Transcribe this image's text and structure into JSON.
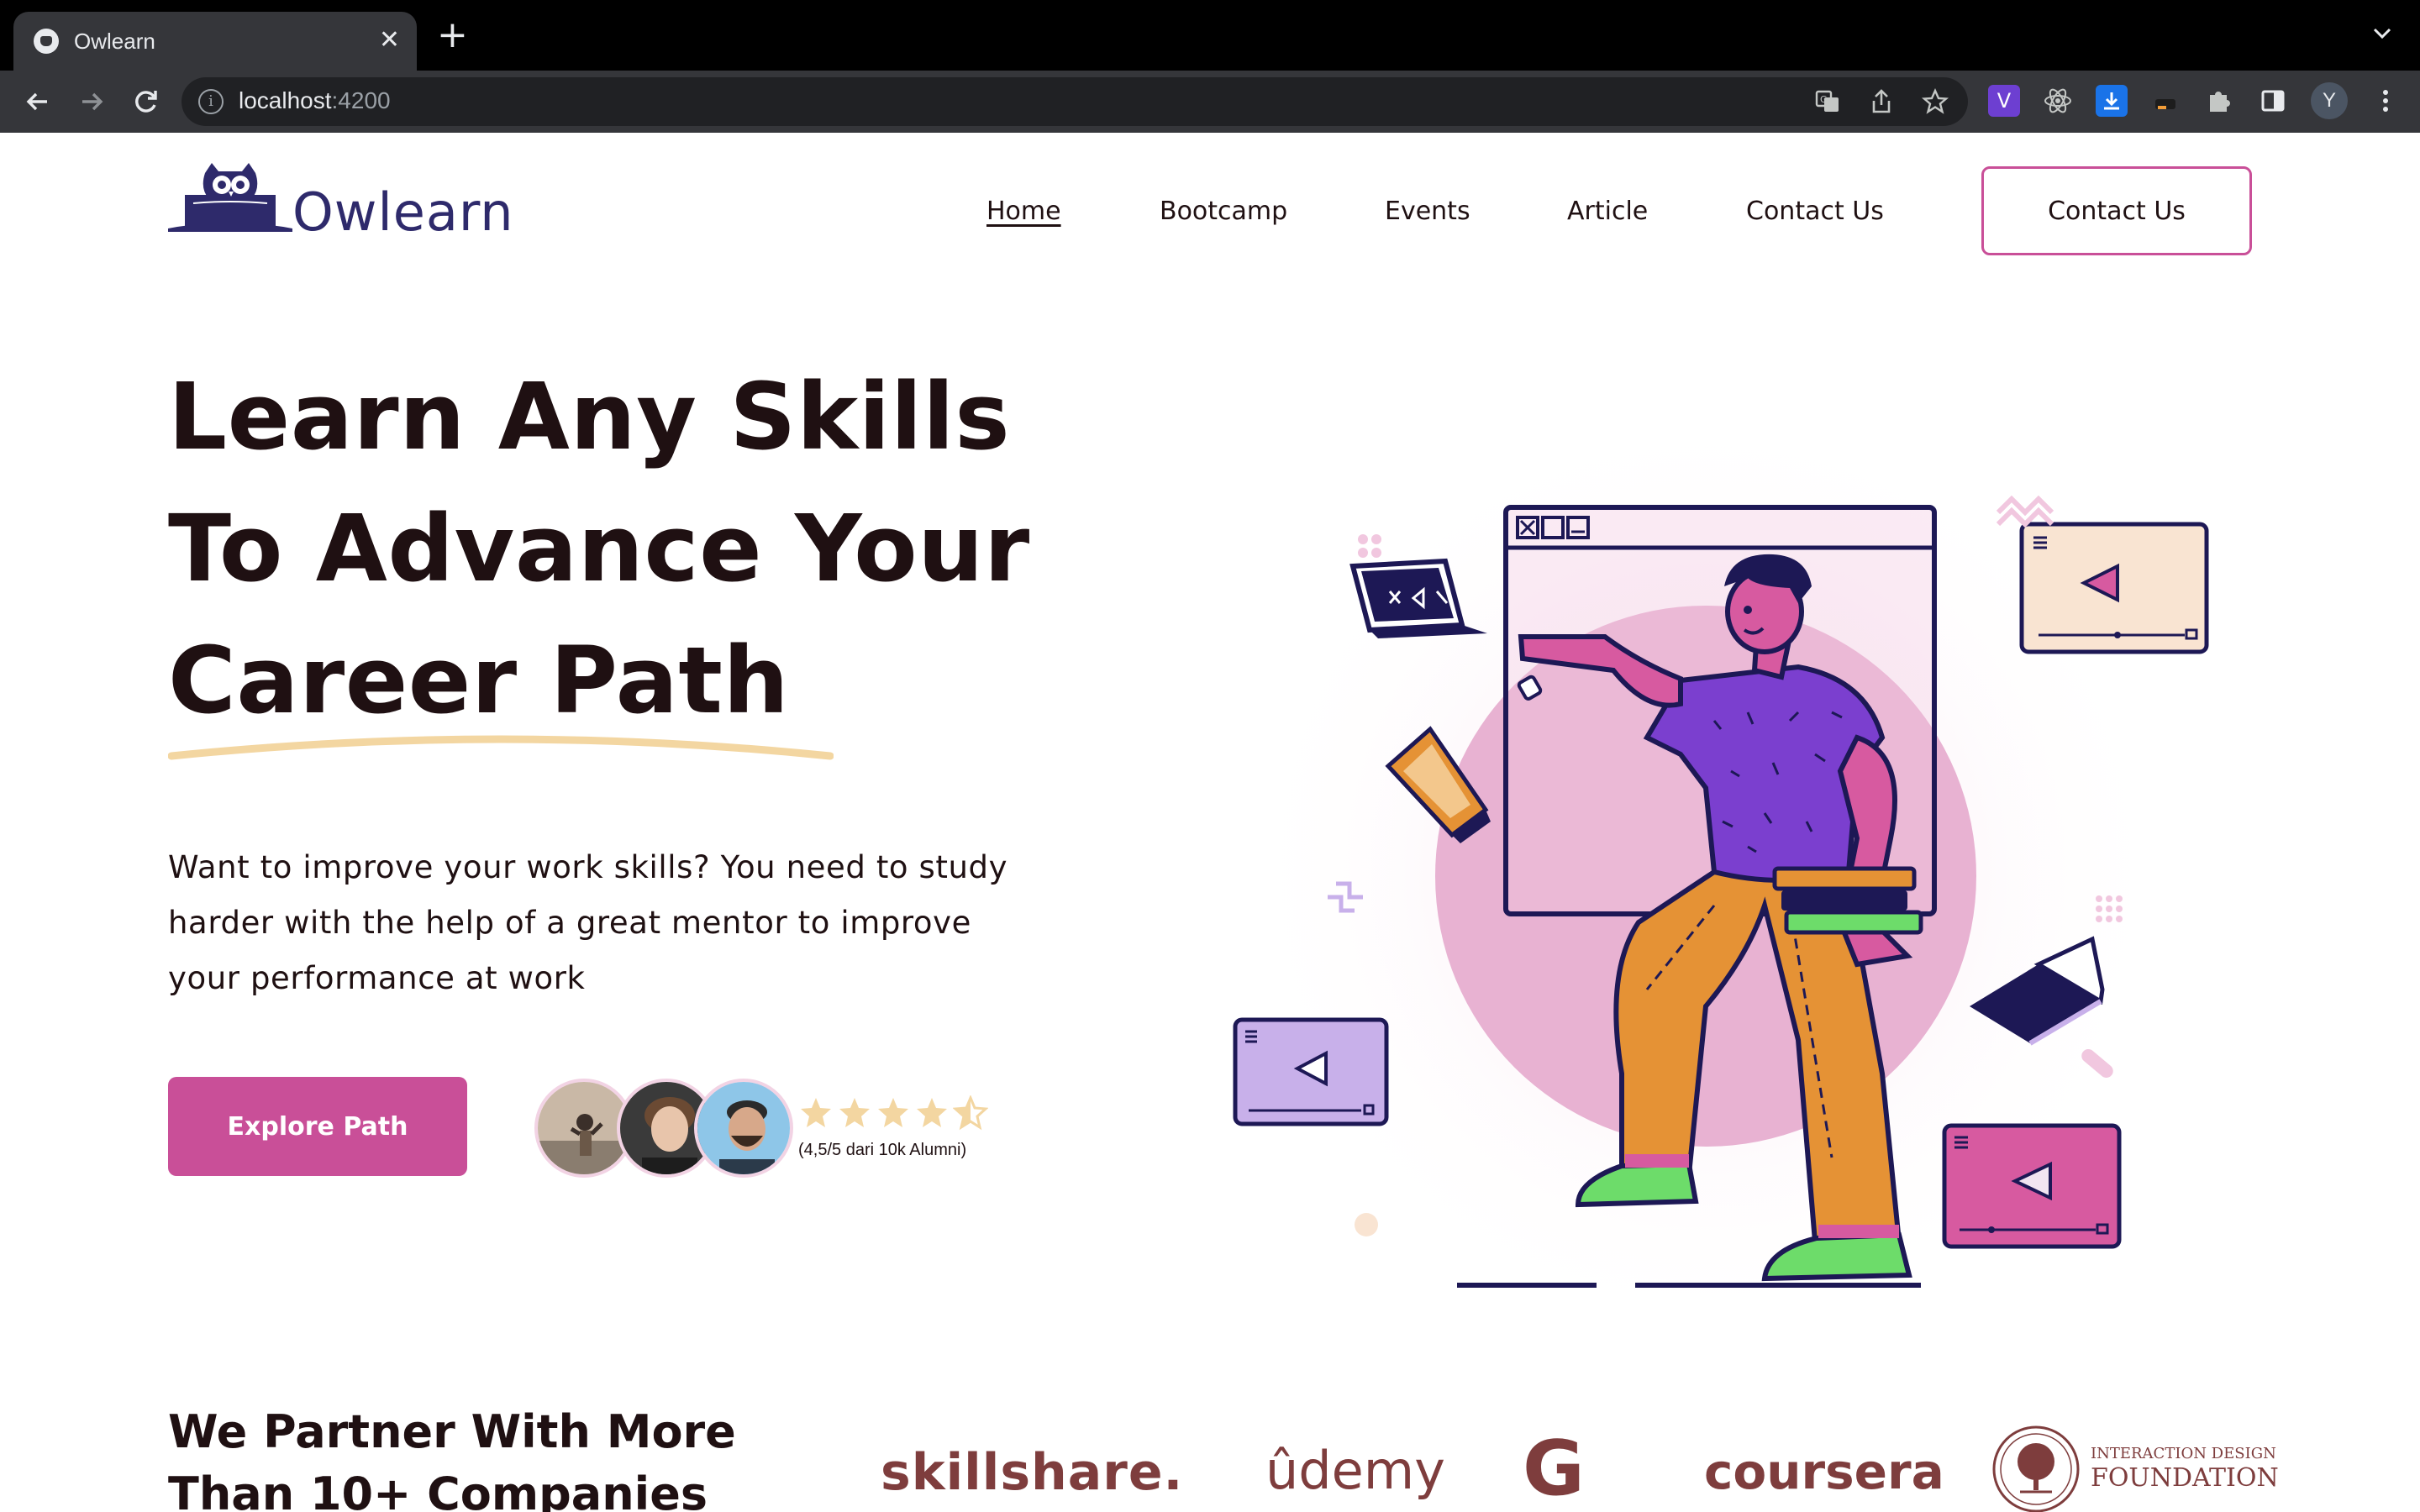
{
  "browser": {
    "tab_title": "Owlearn",
    "tab_close": "✕",
    "new_tab": "+",
    "url_host": "localhost",
    "url_port": ":4200",
    "profile_initial": "Y"
  },
  "header": {
    "logo_text": "Owlearn",
    "nav": [
      {
        "label": "Home",
        "active": true
      },
      {
        "label": "Bootcamp",
        "active": false
      },
      {
        "label": "Events",
        "active": false
      },
      {
        "label": "Article",
        "active": false
      },
      {
        "label": "Contact Us",
        "active": false
      }
    ],
    "cta_label": "Contact Us"
  },
  "hero": {
    "title_lines": [
      "Learn Any Skills",
      "To Advance Your",
      "Career Path"
    ],
    "description": "Want to improve your work skills? You need to study harder with the help of a great mentor to improve your performance at work",
    "cta_label": "Explore Path",
    "rating_value": 4.5,
    "rating_max": 5,
    "rating_text": "(4,5/5 dari 10k Alumni)"
  },
  "partners": {
    "title_lines": [
      "We Partner With More",
      "Than 10+ Companies"
    ],
    "logos": [
      "skillshare.",
      "ûdemy",
      "G",
      "coursera"
    ],
    "idf_small": "INTERACTION DESIGN",
    "idf_big": "FOUNDATION"
  },
  "colors": {
    "brand": "#c94f98",
    "navy": "#2e2a6b",
    "text": "#1f1012",
    "underline": "#f3d6a1",
    "partner": "#7e3d3d"
  }
}
